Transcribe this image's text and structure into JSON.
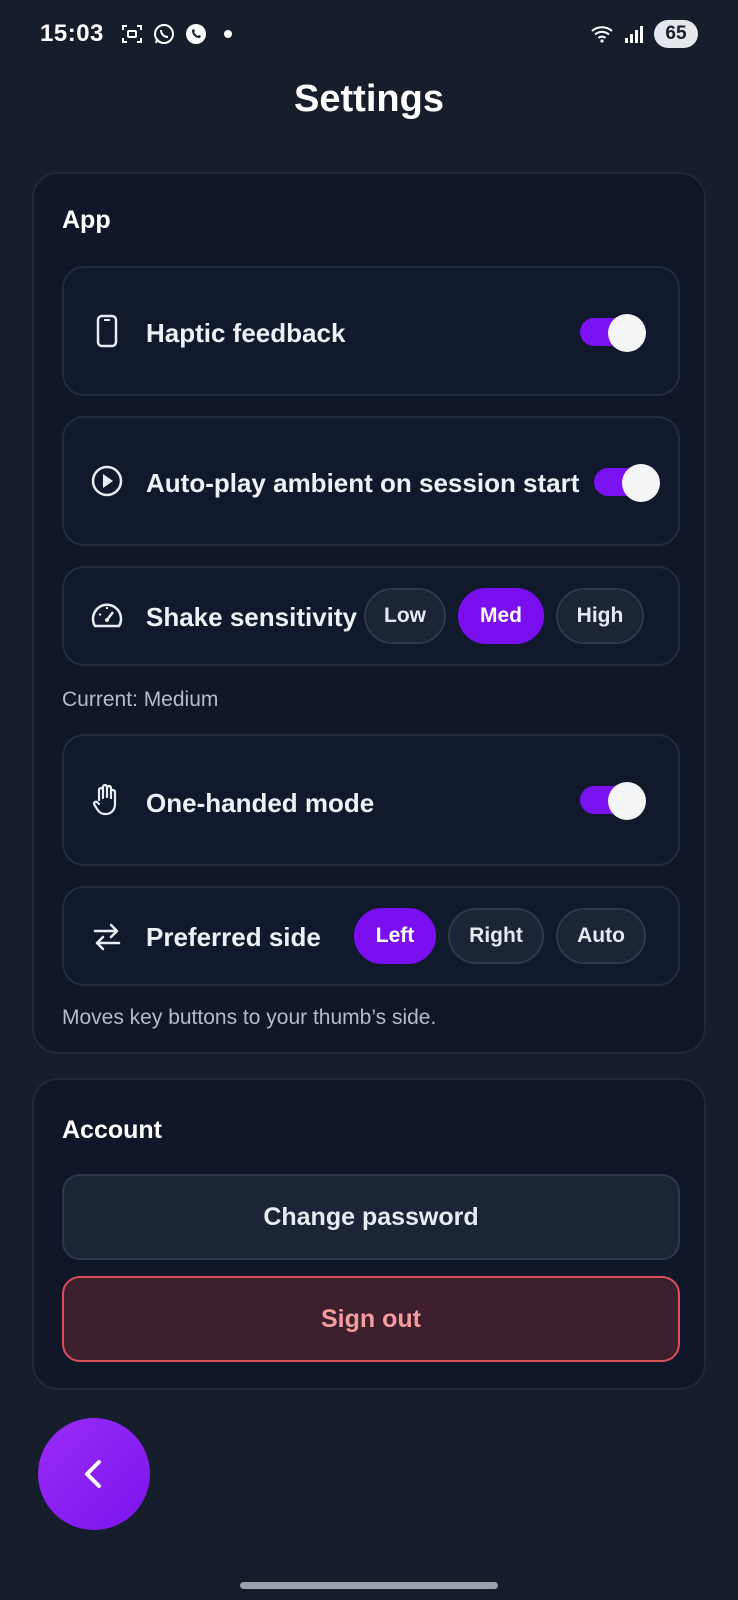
{
  "status_bar": {
    "time": "15:03",
    "battery": "65",
    "icons": [
      "scan-icon",
      "whatsapp-icon",
      "viber-icon",
      "dot-icon",
      "wifi-icon",
      "signal-icon"
    ]
  },
  "page": {
    "title": "Settings"
  },
  "app_section": {
    "title": "App",
    "haptic": {
      "label": "Haptic feedback",
      "icon": "phone-icon",
      "enabled": true
    },
    "autoplay": {
      "label": "Auto-play ambient on session start",
      "icon": "play-circle-icon",
      "enabled": true
    },
    "shake": {
      "label": "Shake sensitivity",
      "icon": "gauge-icon",
      "options": [
        "Low",
        "Med",
        "High"
      ],
      "selected": "Med",
      "current_text": "Current: Medium"
    },
    "one_handed": {
      "label": "One-handed mode",
      "icon": "hand-icon",
      "enabled": true
    },
    "preferred_side": {
      "label": "Preferred side",
      "icon": "swap-arrows-icon",
      "options": [
        "Left",
        "Right",
        "Auto"
      ],
      "selected": "Left",
      "hint": "Moves key buttons to your thumb’s side."
    }
  },
  "account_section": {
    "title": "Account",
    "change_password": "Change password",
    "sign_out": "Sign out"
  },
  "fab": {
    "icon": "chevron-left-icon"
  },
  "colors": {
    "background": "#161e2b",
    "card": "#0f1729",
    "accent": "#7b0ff0",
    "danger_border": "#d9505a",
    "danger_text": "#f59c9d"
  }
}
